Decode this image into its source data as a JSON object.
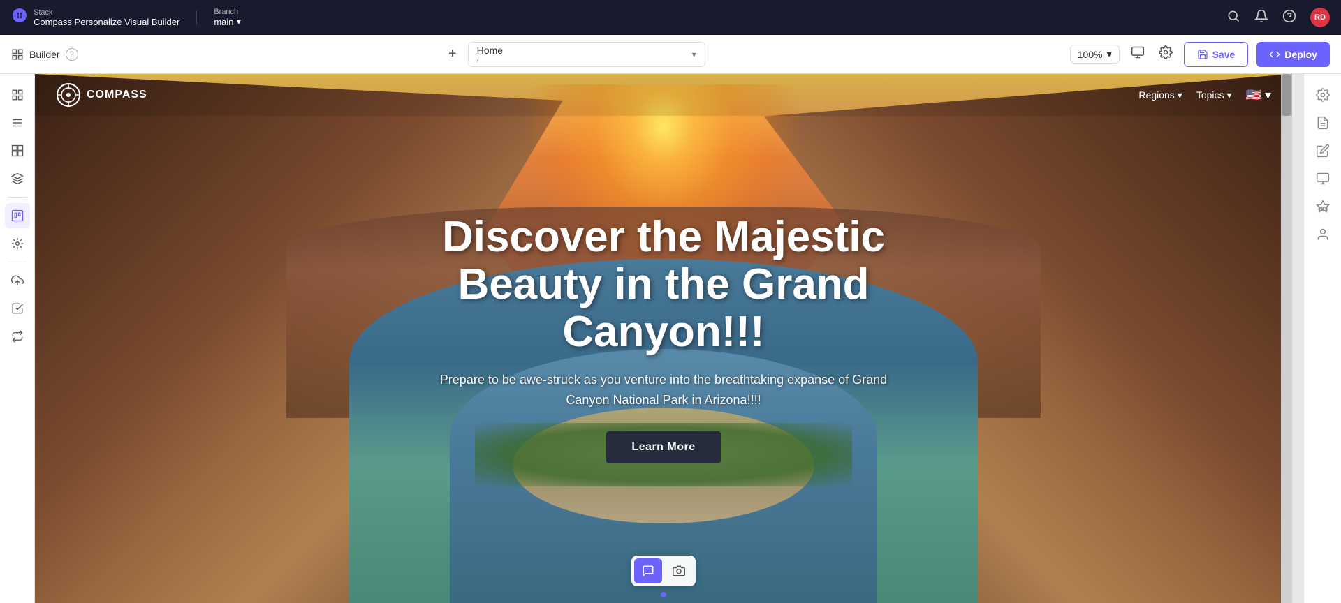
{
  "app": {
    "stack_label": "Stack",
    "app_name": "Compass Personalize Visual Builder",
    "branch_label": "Branch",
    "branch_value": "main"
  },
  "topbar": {
    "search_icon": "search",
    "notifications_icon": "bell",
    "help_icon": "question",
    "avatar_initials": "RD"
  },
  "builder_bar": {
    "builder_label": "Builder",
    "add_page_label": "+",
    "page_name": "Home",
    "page_path": "/",
    "zoom_value": "100%",
    "save_label": "Save",
    "deploy_label": "Deploy"
  },
  "site": {
    "logo_text": "COMPASS",
    "nav_regions": "Regions",
    "nav_topics": "Topics",
    "hero_title": "Discover the Majestic Beauty in the Grand Canyon!!!",
    "hero_subtitle": "Prepare to be awe-struck as you venture into the breathtaking expanse of Grand Canyon National Park in Arizona!!!!",
    "hero_cta": "Learn More"
  },
  "left_sidebar": {
    "items": [
      {
        "name": "grid-icon",
        "icon": "⊞",
        "label": "Pages"
      },
      {
        "name": "layout-icon",
        "icon": "≡",
        "label": "Layout"
      },
      {
        "name": "components-icon",
        "icon": "⊡",
        "label": "Components"
      },
      {
        "name": "layers-icon",
        "icon": "⧉",
        "label": "Layers"
      },
      {
        "name": "selected-component-icon",
        "icon": "⊞",
        "label": "Selected",
        "active": true
      },
      {
        "name": "widgets-icon",
        "icon": "⊞",
        "label": "Widgets"
      },
      {
        "name": "upload-icon",
        "icon": "↑",
        "label": "Upload"
      },
      {
        "name": "checklist-icon",
        "icon": "☑",
        "label": "Checklist"
      },
      {
        "name": "connections-icon",
        "icon": "⇌",
        "label": "Connections"
      }
    ]
  },
  "right_sidebar": {
    "items": [
      {
        "name": "properties-icon",
        "label": "Properties"
      },
      {
        "name": "content-icon",
        "label": "Content"
      },
      {
        "name": "edit-icon",
        "label": "Edit"
      },
      {
        "name": "responsive-icon",
        "label": "Responsive"
      },
      {
        "name": "shapes-icon",
        "label": "Shapes"
      },
      {
        "name": "user-icon",
        "label": "User"
      }
    ]
  },
  "canvas_toolbar": {
    "comment_btn": "💬",
    "screenshot_btn": "📷"
  }
}
